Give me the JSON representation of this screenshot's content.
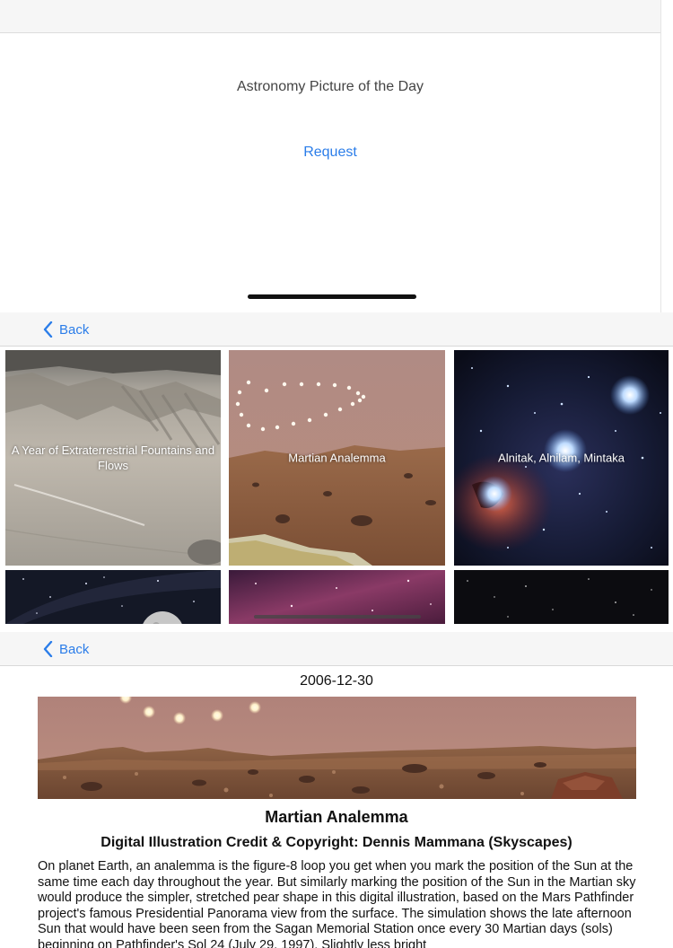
{
  "home": {
    "title": "Astronomy Picture of the Day",
    "request_label": "Request"
  },
  "gallery": {
    "back_label": "Back",
    "tiles": [
      {
        "caption": "A Year of Extraterrestrial Fountains and Flows"
      },
      {
        "caption": "Martian Analemma"
      },
      {
        "caption": "Alnitak, Alnilam, Mintaka"
      },
      {
        "caption": ""
      },
      {
        "caption": ""
      },
      {
        "caption": ""
      }
    ]
  },
  "detail": {
    "back_label": "Back",
    "date": "2006-12-30",
    "title": "Martian Analemma",
    "credit": "Digital Illustration Credit & Copyright: Dennis Mammana (Skyscapes)",
    "explanation": "On planet Earth, an analemma is the figure-8 loop you get when you mark the position of the Sun at the same time each day throughout the year. But similarly marking the position of the Sun in the Martian sky would produce the simpler, stretched pear shape in this digital illustration, based on the Mars Pathfinder project's famous Presidential Panorama view from the surface. The simulation shows the late afternoon Sun that would have been seen from the Sagan Memorial Station once every 30 Martian days (sols) beginning on Pathfinder's Sol 24 (July 29, 1997). Slightly less bright"
  },
  "colors": {
    "accent": "#2b7de9",
    "navbar_bg": "#f6f6f6",
    "mars_sky": "#b4837a",
    "mars_ground": "#8a5a3c"
  }
}
